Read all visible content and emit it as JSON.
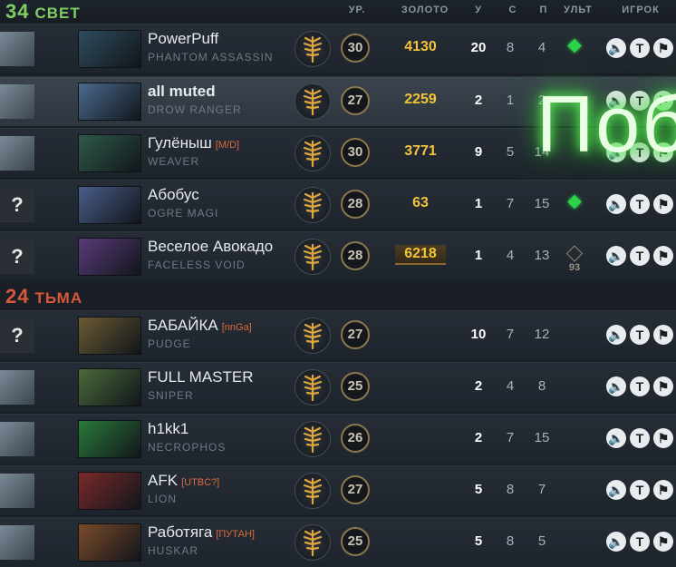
{
  "columns": {
    "level": "УР.",
    "gold": "ЗОЛОТО",
    "kills": "У",
    "deaths": "С",
    "assists": "П",
    "ult": "УЛЬТ",
    "player": "ИГРОК"
  },
  "radiant": {
    "score": "34",
    "name": "СВЕТ",
    "color": "#7fcf63"
  },
  "dire": {
    "score": "24",
    "name": "ТЬМА",
    "color": "#d8583b"
  },
  "victory_text": "Поб",
  "buttons": {
    "mute_icon": "speaker-icon",
    "text_icon": "T",
    "report_icon": "flag-icon"
  },
  "players": [
    {
      "name": "PowerPuff",
      "tag": "",
      "hero": "PHANTOM ASSASSIN",
      "level": "30",
      "gold": "4130",
      "kills": "20",
      "deaths": "8",
      "assists": "4",
      "ult": "ready",
      "ult_cd": "",
      "avatar": "pic",
      "hero_color": "#2e4c5e"
    },
    {
      "name": "all muted",
      "tag": "",
      "hero": "DROW RANGER",
      "level": "27",
      "gold": "2259",
      "kills": "2",
      "deaths": "1",
      "assists": "2",
      "ult": "",
      "ult_cd": "",
      "avatar": "pic",
      "hero_color": "#4a6a8e"
    },
    {
      "name": "Гулёныш",
      "tag": "[M/D]",
      "hero": "WEAVER",
      "level": "30",
      "gold": "3771",
      "kills": "9",
      "deaths": "5",
      "assists": "14",
      "ult": "",
      "ult_cd": "",
      "avatar": "pic",
      "hero_color": "#2f5a4a"
    },
    {
      "name": "Абобус",
      "tag": "",
      "hero": "OGRE MAGI",
      "level": "28",
      "gold": "63",
      "kills": "1",
      "deaths": "7",
      "assists": "15",
      "ult": "ready",
      "ult_cd": "",
      "avatar": "unknown",
      "hero_color": "#4a5e8a"
    },
    {
      "name": "Веселое Авокадо",
      "tag": "",
      "hero": "FACELESS VOID",
      "level": "28",
      "gold": "6218",
      "kills": "1",
      "deaths": "4",
      "assists": "13",
      "ult": "cd",
      "ult_cd": "93",
      "avatar": "unknown",
      "hero_color": "#5a3a7a"
    },
    {
      "name": "БАБАЙКА",
      "tag": "[nnGa]",
      "hero": "PUDGE",
      "level": "27",
      "gold": "",
      "kills": "10",
      "deaths": "7",
      "assists": "12",
      "ult": "",
      "ult_cd": "",
      "avatar": "unknown",
      "hero_color": "#6a5a32"
    },
    {
      "name": "FULL MASTER",
      "tag": "",
      "hero": "SNIPER",
      "level": "25",
      "gold": "",
      "kills": "2",
      "deaths": "4",
      "assists": "8",
      "ult": "",
      "ult_cd": "",
      "avatar": "pic",
      "hero_color": "#4a6a3a"
    },
    {
      "name": "h1kk1",
      "tag": "",
      "hero": "NECROPHOS",
      "level": "26",
      "gold": "",
      "kills": "2",
      "deaths": "7",
      "assists": "15",
      "ult": "",
      "ult_cd": "",
      "avatar": "pic",
      "hero_color": "#2a7a3a"
    },
    {
      "name": "AFK",
      "tag": "[UTBC?]",
      "hero": "LION",
      "level": "27",
      "gold": "",
      "kills": "5",
      "deaths": "8",
      "assists": "7",
      "ult": "",
      "ult_cd": "",
      "avatar": "pic",
      "hero_color": "#7a2a2a"
    },
    {
      "name": "Работяга",
      "tag": "[ПУТАН]",
      "hero": "HUSKAR",
      "level": "25",
      "gold": "",
      "kills": "5",
      "deaths": "8",
      "assists": "5",
      "ult": "",
      "ult_cd": "",
      "avatar": "pic",
      "hero_color": "#7a4a2a"
    }
  ]
}
